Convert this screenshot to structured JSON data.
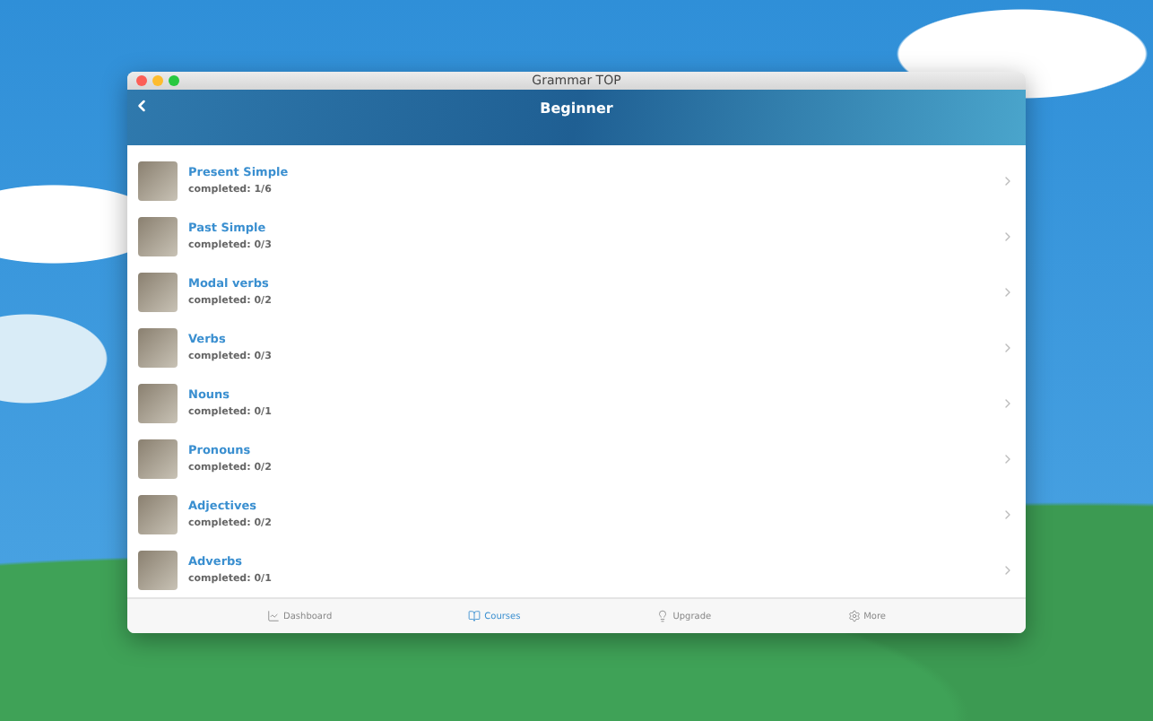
{
  "window": {
    "title": "Grammar TOP"
  },
  "header": {
    "title": "Beginner"
  },
  "lessons": [
    {
      "title": "Present Simple",
      "progress": "completed: 1/6"
    },
    {
      "title": "Past Simple",
      "progress": "completed: 0/3"
    },
    {
      "title": "Modal verbs",
      "progress": "completed: 0/2"
    },
    {
      "title": "Verbs",
      "progress": "completed: 0/3"
    },
    {
      "title": "Nouns",
      "progress": "completed: 0/1"
    },
    {
      "title": "Pronouns",
      "progress": "completed: 0/2"
    },
    {
      "title": "Adjectives",
      "progress": "completed: 0/2"
    },
    {
      "title": "Adverbs",
      "progress": "completed: 0/1"
    }
  ],
  "tabs": [
    {
      "label": "Dashboard",
      "kind": "chart",
      "selected": false
    },
    {
      "label": "Courses",
      "kind": "book",
      "selected": true
    },
    {
      "label": "Upgrade",
      "kind": "bulb",
      "selected": false
    },
    {
      "label": "More",
      "kind": "gear",
      "selected": false
    }
  ]
}
